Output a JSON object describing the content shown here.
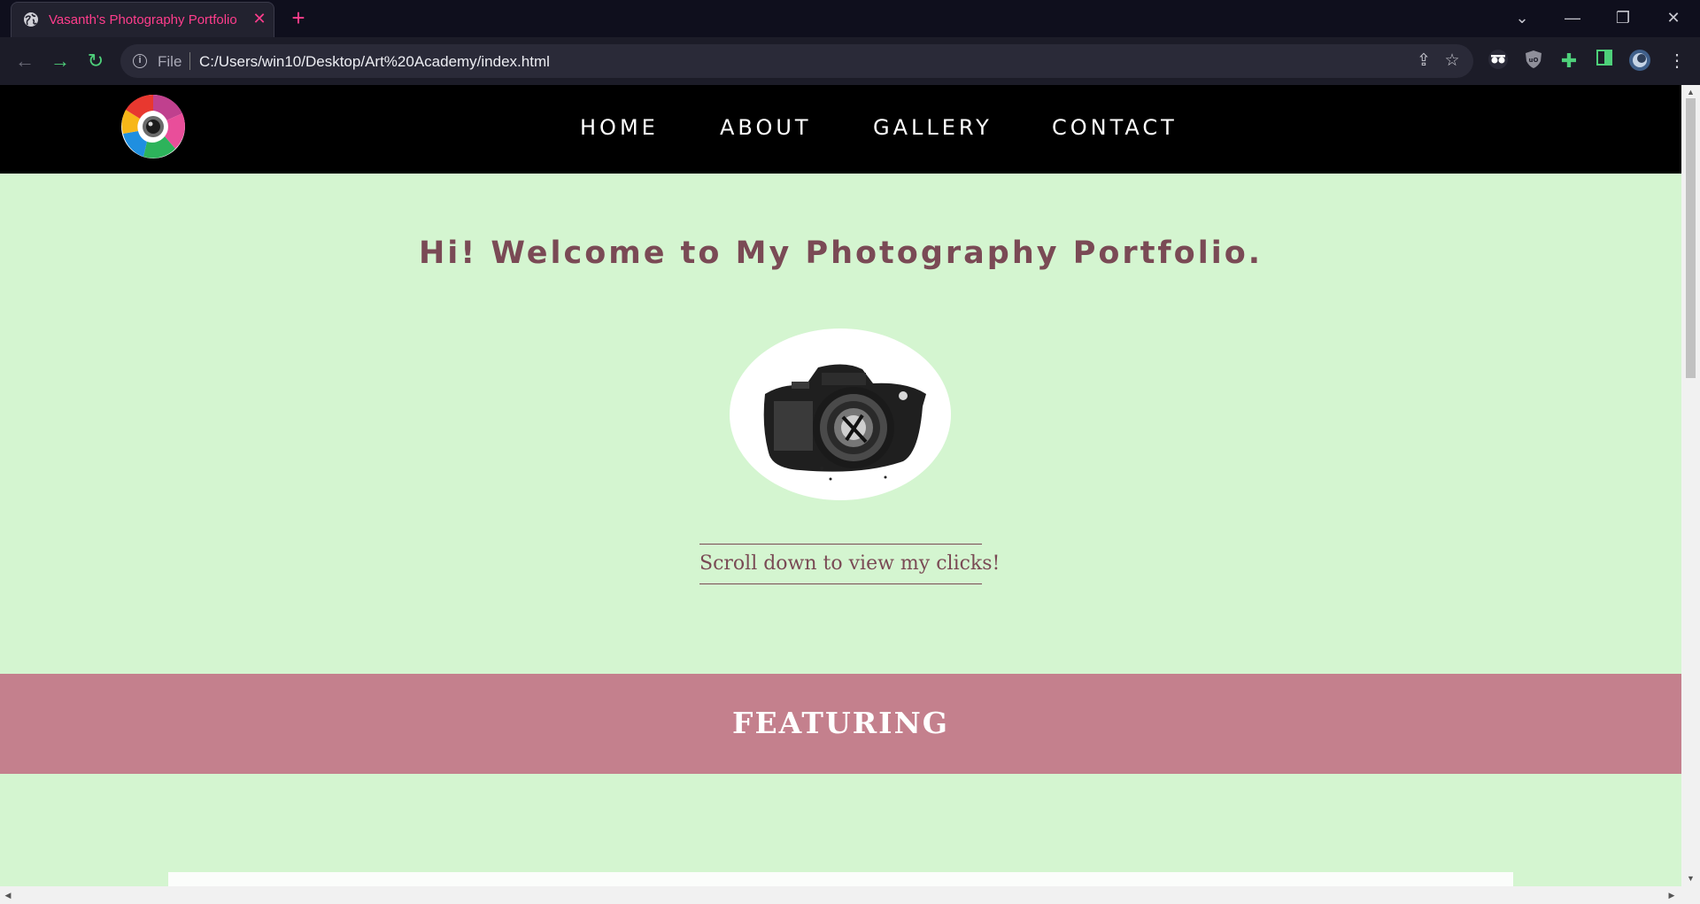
{
  "browser": {
    "tab_title": "Vasanth's Photography Portfolio",
    "file_label": "File",
    "url": "C:/Users/win10/Desktop/Art%20Academy/index.html"
  },
  "nav": {
    "links": [
      "HOME",
      "ABOUT",
      "GALLERY",
      "CONTACT"
    ]
  },
  "hero": {
    "title": "Hi! Welcome to My Photography Portfolio.",
    "cta": "Scroll down to view my clicks!"
  },
  "featuring": {
    "title": "FEATURING"
  },
  "colors": {
    "page_bg": "#d4f5d0",
    "accent_text": "#7a4a55",
    "featuring_band": "#c4808d",
    "tab_accent": "#ff3d8c",
    "nav_bg": "#000000"
  },
  "icons": {
    "tab": "globe-icon",
    "toolbar": [
      "back-icon",
      "forward-icon",
      "reload-icon",
      "info-icon",
      "share-icon",
      "star-icon"
    ],
    "extensions": [
      "spy-glasses-icon",
      "ublock-icon",
      "puzzle-icon",
      "sidepanel-icon",
      "profile-avatar"
    ]
  }
}
